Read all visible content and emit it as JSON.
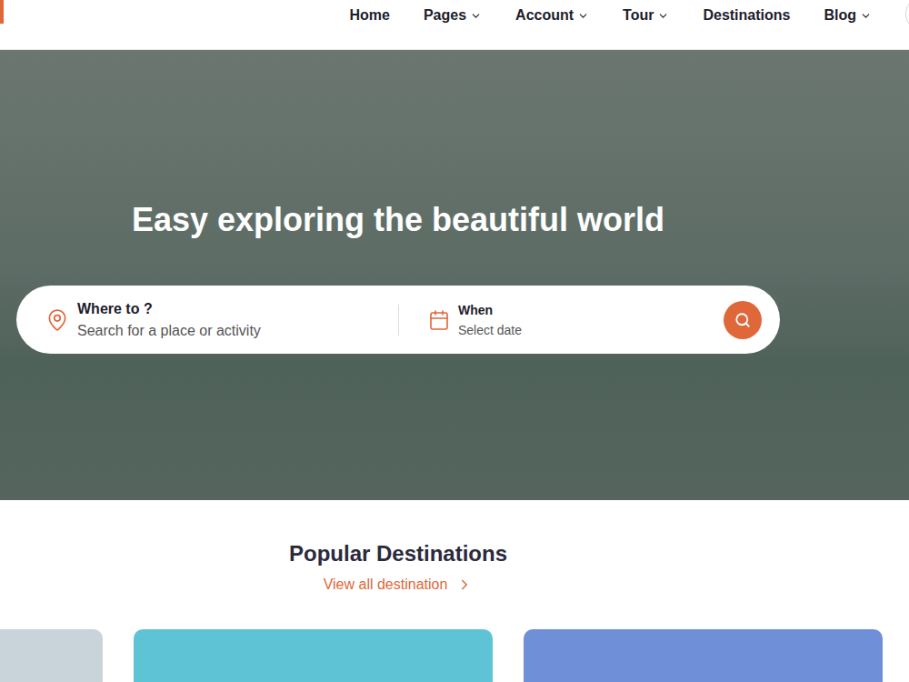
{
  "header": {
    "nav": [
      {
        "label": "Home",
        "dropdown": false
      },
      {
        "label": "Pages",
        "dropdown": true
      },
      {
        "label": "Account",
        "dropdown": true
      },
      {
        "label": "Tour",
        "dropdown": true
      },
      {
        "label": "Destinations",
        "dropdown": false
      },
      {
        "label": "Blog",
        "dropdown": true
      }
    ]
  },
  "hero": {
    "title": "Easy exploring the beautiful world",
    "search": {
      "where": {
        "label": "Where to ?",
        "placeholder": "Search for a place or activity"
      },
      "when": {
        "label": "When",
        "placeholder": "Select date"
      }
    }
  },
  "destinations": {
    "title": "Popular Destinations",
    "link": "View all destination",
    "cards": [
      {
        "color": "#c9d3da"
      },
      {
        "color": "#5fc3d6"
      },
      {
        "color": "#6f8fd8"
      }
    ]
  }
}
